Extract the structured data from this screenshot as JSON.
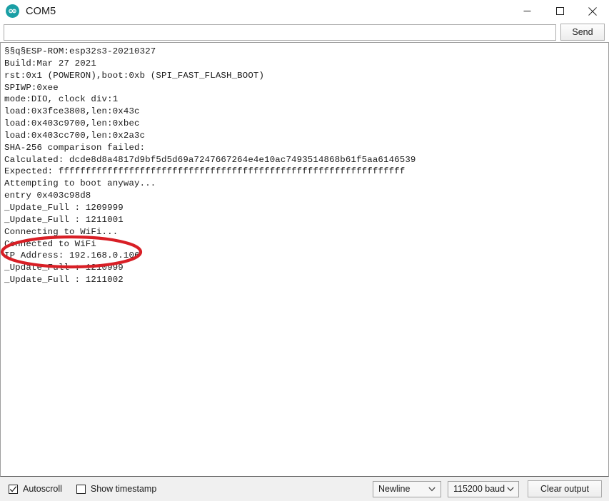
{
  "window": {
    "title": "COM5",
    "icon": "arduino-icon",
    "minimize_label": "Minimize",
    "maximize_label": "Maximize",
    "close_label": "Close"
  },
  "send_row": {
    "input_value": "",
    "input_placeholder": "",
    "send_label": "Send"
  },
  "console": {
    "lines": [
      "§§q§ESP-ROM:esp32s3-20210327",
      "Build:Mar 27 2021",
      "rst:0x1 (POWERON),boot:0xb (SPI_FAST_FLASH_BOOT)",
      "SPIWP:0xee",
      "mode:DIO, clock div:1",
      "load:0x3fce3808,len:0x43c",
      "load:0x403c9700,len:0xbec",
      "load:0x403cc700,len:0x2a3c",
      "SHA-256 comparison failed:",
      "Calculated: dcde8d8a4817d9bf5d5d69a7247667264e4e10ac7493514868b61f5aa6146539",
      "Expected: ffffffffffffffffffffffffffffffffffffffffffffffffffffffffffffffff",
      "Attempting to boot anyway...",
      "entry 0x403c98d8",
      "_Update_Full : 1209999",
      "_Update_Full : 1211001",
      "Connecting to WiFi...",
      "Connected to WiFi",
      "IP Address: 192.168.0.106",
      "_Update_Full : 1210999",
      "_Update_Full : 1211002"
    ],
    "annotation": {
      "name": "red-ellipse-highlight",
      "color": "#d81f26",
      "stroke_width": 4,
      "covers": [
        "Connected to WiFi",
        "IP Address: 192.168.0.106"
      ]
    }
  },
  "bottom_bar": {
    "autoscroll_label": "Autoscroll",
    "autoscroll_checked": true,
    "show_timestamp_label": "Show timestamp",
    "show_timestamp_checked": false,
    "line_ending": "Newline",
    "baud_rate": "115200 baud",
    "clear_label": "Clear output"
  }
}
